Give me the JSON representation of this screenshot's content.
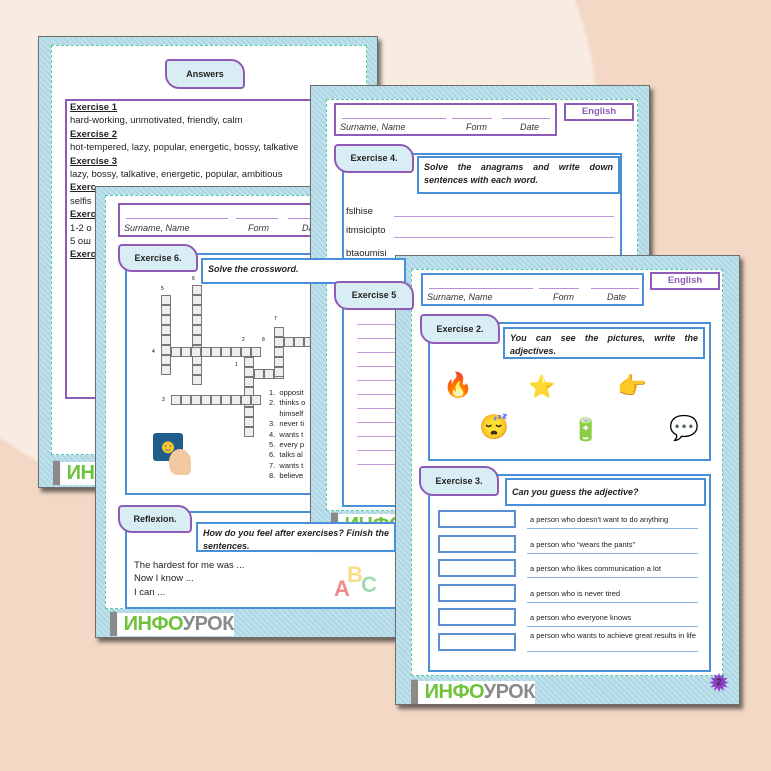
{
  "header": {
    "surname": "Surname, Name",
    "form": "Form",
    "date": "Date",
    "subject": "English"
  },
  "logo": {
    "prefix": "ИНФО",
    "suffix": "УРОК"
  },
  "answers": {
    "title": "Answers",
    "lines": [
      {
        "h": "Exercise 1"
      },
      {
        "t": "hard-working, unmotivated, friendly, calm"
      },
      {
        "h": "Exercise 2"
      },
      {
        "t": "hot-tempered, lazy, popular, energetic, bossy, talkative"
      },
      {
        "h": "Exercise 3"
      },
      {
        "t": "lazy, bossy, talkative, energetic, popular, ambitious"
      },
      {
        "h": "Exerc"
      },
      {
        "t": "selfis"
      },
      {
        "h": "Exerc"
      },
      {
        "t": "1-2 o"
      },
      {
        "t": "5 ош"
      },
      {
        "h": "Exerc"
      }
    ]
  },
  "ex6": {
    "tab": "Exercise 6.",
    "instruction": "Solve the crossword.",
    "clues": [
      "1.  opposit",
      "2.  thinks o",
      "     himself",
      "3.  never ti",
      "4.  wants t",
      "5.  every p",
      "6.  talks al",
      "7.  wants t",
      "8.  believe"
    ],
    "numbers": [
      "5",
      "6",
      "4",
      "2",
      "8",
      "7",
      "1",
      "3"
    ]
  },
  "reflexion": {
    "tab": "Reflexion.",
    "instruction": "How do you feel after exercises? Finish the sentences.",
    "sentences": [
      "The hardest for me was ...",
      "Now I know ...",
      "I can ..."
    ],
    "abc": [
      "A",
      "B",
      "C"
    ]
  },
  "ex4": {
    "tab": "Exercise 4.",
    "instruction": "Solve the anagrams and write down sentences with each word.",
    "words": [
      "fslhise",
      "itmsicipto",
      "btaoumisi"
    ]
  },
  "ex5": {
    "tab": "Exercise 5"
  },
  "ex2": {
    "tab": "Exercise 2.",
    "instruction": "You can see the pictures, write the adjectives.",
    "icons": [
      "hot-tempered-person-icon",
      "popular-person-icon",
      "bossy-person-icon",
      "lazy-person-icon",
      "energetic-person-icon",
      "talkative-person-icon"
    ]
  },
  "ex3": {
    "tab": "Exercise 3.",
    "instruction": "Can you guess the adjective?",
    "definitions": [
      "a person who doesn't want to do anything",
      "a person who “wears the pants”",
      "a person who likes communication a lot",
      "a person who is never tired",
      "a person who everyone knows",
      "a person who wants to achieve great results in life"
    ]
  },
  "page_number": "2"
}
